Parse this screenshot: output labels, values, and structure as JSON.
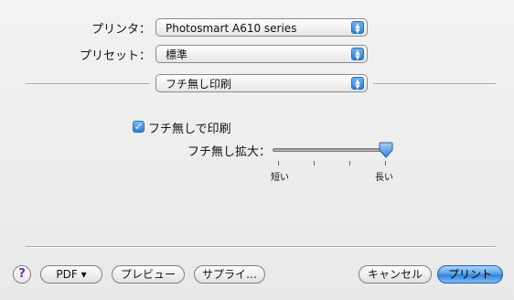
{
  "printer": {
    "label": "プリンタ：",
    "value": "Photosmart A610 series"
  },
  "preset": {
    "label": "プリセット：",
    "value": "標準"
  },
  "pane": {
    "value": "フチ無し印刷"
  },
  "borderless": {
    "checkbox_label": "フチ無しで印刷",
    "checked": true
  },
  "expansion": {
    "label": "フチ無し拡大：",
    "min_label": "短い",
    "max_label": "長い",
    "level": 1.0
  },
  "buttons": {
    "help": "?",
    "pdf": "PDF ▾",
    "preview": "プレビュー",
    "supplies": "サプライ…",
    "cancel": "キャンセル",
    "print": "プリント"
  },
  "colors": {
    "accent": "#2f7fd8",
    "background": "#ececec"
  }
}
